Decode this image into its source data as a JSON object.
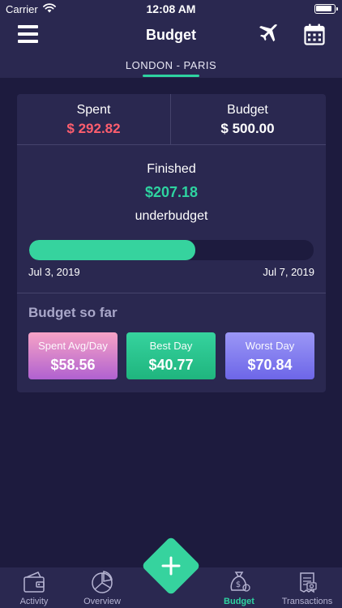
{
  "status_bar": {
    "carrier": "Carrier",
    "time": "12:08 AM"
  },
  "nav": {
    "title": "Budget",
    "trip": "LONDON - PARIS"
  },
  "summary": {
    "spent_label": "Spent",
    "spent_value": "$ 292.82",
    "budget_label": "Budget",
    "budget_value": "$ 500.00"
  },
  "status": {
    "label": "Finished",
    "amount": "$207.18",
    "note": "underbudget"
  },
  "progress": {
    "fraction": 0.585,
    "start_date": "Jul 3, 2019",
    "end_date": "Jul 7, 2019"
  },
  "so_far": {
    "title": "Budget so far",
    "tiles": [
      {
        "label": "Spent Avg/Day",
        "value": "$58.56"
      },
      {
        "label": "Best Day",
        "value": "$40.77"
      },
      {
        "label": "Worst Day",
        "value": "$70.84"
      }
    ]
  },
  "tabbar": {
    "items": [
      {
        "label": "Activity",
        "icon": "wallet-icon"
      },
      {
        "label": "Overview",
        "icon": "pie-chart-icon"
      },
      {
        "label": "Budget",
        "icon": "money-bag-icon",
        "active": true
      },
      {
        "label": "Transactions",
        "icon": "receipt-icon"
      }
    ],
    "add_icon": "plus-icon"
  },
  "colors": {
    "accent": "#2ed3a0",
    "spent": "#ff5e6e",
    "background": "#1d1b3e",
    "panel": "#2a2850"
  }
}
